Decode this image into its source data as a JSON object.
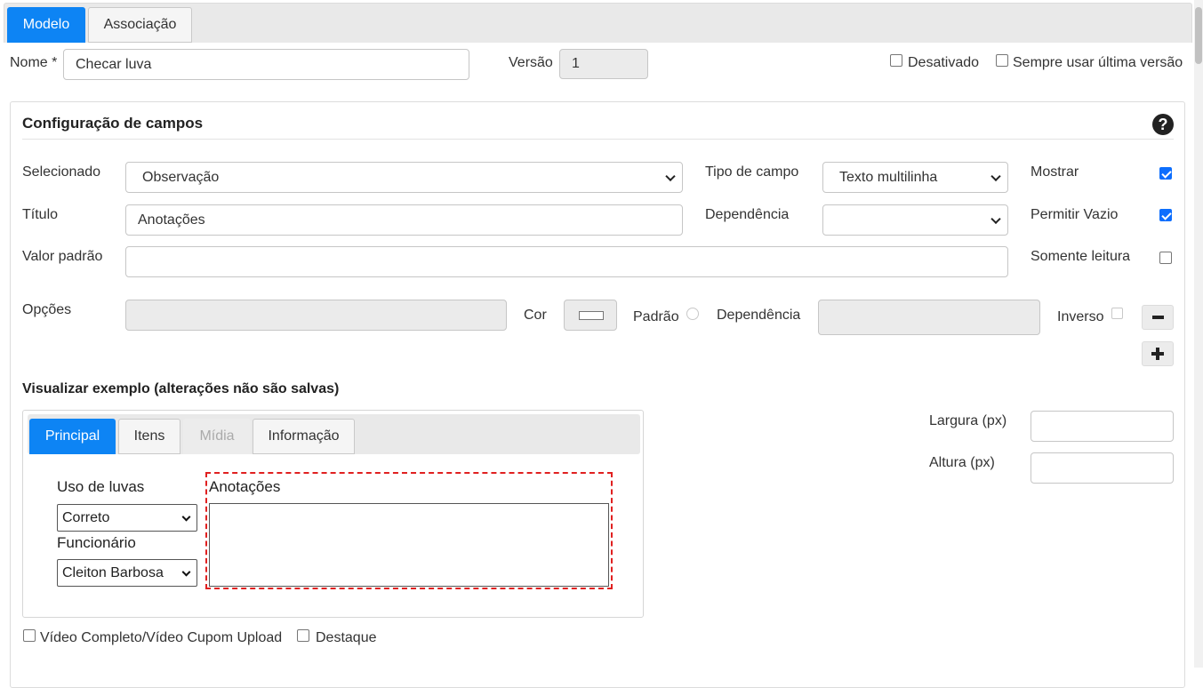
{
  "tabs": {
    "modelo": "Modelo",
    "associacao": "Associação"
  },
  "form": {
    "nome_label": "Nome *",
    "nome_value": "Checar luva",
    "versao_label": "Versão",
    "versao_value": "1",
    "desativado_label": "Desativado",
    "desativado_checked": false,
    "sempre_label": "Sempre usar última versão",
    "sempre_checked": false
  },
  "config": {
    "title": "Configuração de campos",
    "help_icon": "question-circle-icon",
    "selecionado_label": "Selecionado",
    "selecionado_value": "Observação",
    "tipo_label": "Tipo de campo",
    "tipo_value": "Texto multilinha",
    "mostrar_label": "Mostrar",
    "mostrar_checked": true,
    "titulo_label": "Título",
    "titulo_value": "Anotações",
    "dependencia_label": "Dependência",
    "dependencia_value": "",
    "permitir_label": "Permitir Vazio",
    "permitir_checked": true,
    "valor_label": "Valor padrão",
    "valor_value": "",
    "somente_label": "Somente leitura",
    "somente_checked": false,
    "opcoes_label": "Opções",
    "cor_label": "Cor",
    "padrao_label": "Padrão",
    "dependencia2_label": "Dependência",
    "inverso_label": "Inverso",
    "minus_icon": "minus-icon",
    "plus_icon": "plus-icon"
  },
  "preview": {
    "title": "Visualizar exemplo (alterações não são salvas)",
    "tabs": [
      "Principal",
      "Itens",
      "Mídia",
      "Informação"
    ],
    "uso_label": "Uso de luvas",
    "uso_value": "Correto",
    "funcionario_label": "Funcionário",
    "funcionario_value": "Cleiton Barbosa",
    "anotacoes_label": "Anotações",
    "anotacoes_value": "",
    "largura_label": "Largura (px)",
    "largura_value": "",
    "altura_label": "Altura (px)",
    "altura_value": ""
  },
  "footer": {
    "video_label": "Vídeo Completo/Vídeo Cupom Upload",
    "video_checked": false,
    "destaque_label": "Destaque",
    "destaque_checked": false
  },
  "colors": {
    "accent": "#0d84f4",
    "checkbox": "#0d6efd",
    "highlight_border": "#e02020"
  }
}
